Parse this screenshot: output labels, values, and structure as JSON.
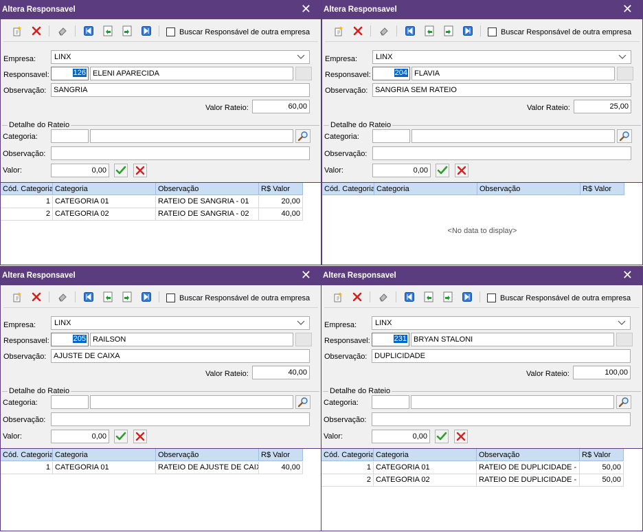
{
  "common": {
    "title": "Altera Responsavel",
    "close": "✕",
    "buscar_label": "Buscar Responsável de outra empresa",
    "empresa_label": "Empresa:",
    "responsavel_label": "Responsavel:",
    "observacao_label": "Observação:",
    "valor_rateio_label": "Valor Rateio:",
    "detalhe_label": "Detalhe do Rateio",
    "categoria_label": "Categoria:",
    "valor_label": "Valor:",
    "valor_value": "0,00",
    "columns": [
      "Cód. Categoria",
      "Categoria",
      "Observação",
      "R$ Valor"
    ],
    "no_data": "<No data to display>"
  },
  "windows": [
    {
      "empresa": "LINX",
      "resp_code": "126",
      "resp_name": "ELENI APARECIDA",
      "observacao": "SANGRIA",
      "valor_rateio": "60,00",
      "rows": [
        {
          "cod": "1",
          "categoria": "CATEGORIA 01",
          "obs": "RATEIO DE SANGRIA - 01",
          "valor": "20,00"
        },
        {
          "cod": "2",
          "categoria": "CATEGORIA 02",
          "obs": "RATEIO DE SANGRIA - 02",
          "valor": "40,00"
        }
      ]
    },
    {
      "empresa": "LINX",
      "resp_code": "204",
      "resp_name": "FLAVIA",
      "observacao": "SANGRIA SEM RATEIO",
      "valor_rateio": "25,00",
      "rows": []
    },
    {
      "empresa": "LINX",
      "resp_code": "205",
      "resp_name": "RAILSON",
      "observacao": "AJUSTE DE CAIXA",
      "valor_rateio": "40,00",
      "rows": [
        {
          "cod": "1",
          "categoria": "CATEGORIA 01",
          "obs": "RATEIO DE AJUSTE DE CAIX",
          "valor": "40,00"
        }
      ]
    },
    {
      "empresa": "LINX",
      "resp_code": "231",
      "resp_name": "BRYAN STALONI",
      "observacao": "DUPLICIDADE",
      "valor_rateio": "100,00",
      "rows": [
        {
          "cod": "1",
          "categoria": "CATEGORIA 01",
          "obs": "RATEIO DE DUPLICIDADE - (",
          "valor": "50,00"
        },
        {
          "cod": "2",
          "categoria": "CATEGORIA 02",
          "obs": "RATEIO DE DUPLICIDADE - (",
          "valor": "50,00"
        }
      ]
    }
  ],
  "icons": {
    "toolbar": [
      "new-doc-icon",
      "delete-x-icon",
      "eraser-icon",
      "first-record-icon",
      "prev-record-icon",
      "next-record-icon",
      "last-record-icon"
    ],
    "confirm": "check-icon",
    "cancel": "cancel-x-icon",
    "search": "magnifier-icon"
  },
  "colors": {
    "titlebar": "#5b3c7f",
    "grid_header": "#c9ddf3",
    "selection": "#0066cc",
    "confirm_green": "#2e9e2e",
    "cancel_red": "#d42020"
  }
}
